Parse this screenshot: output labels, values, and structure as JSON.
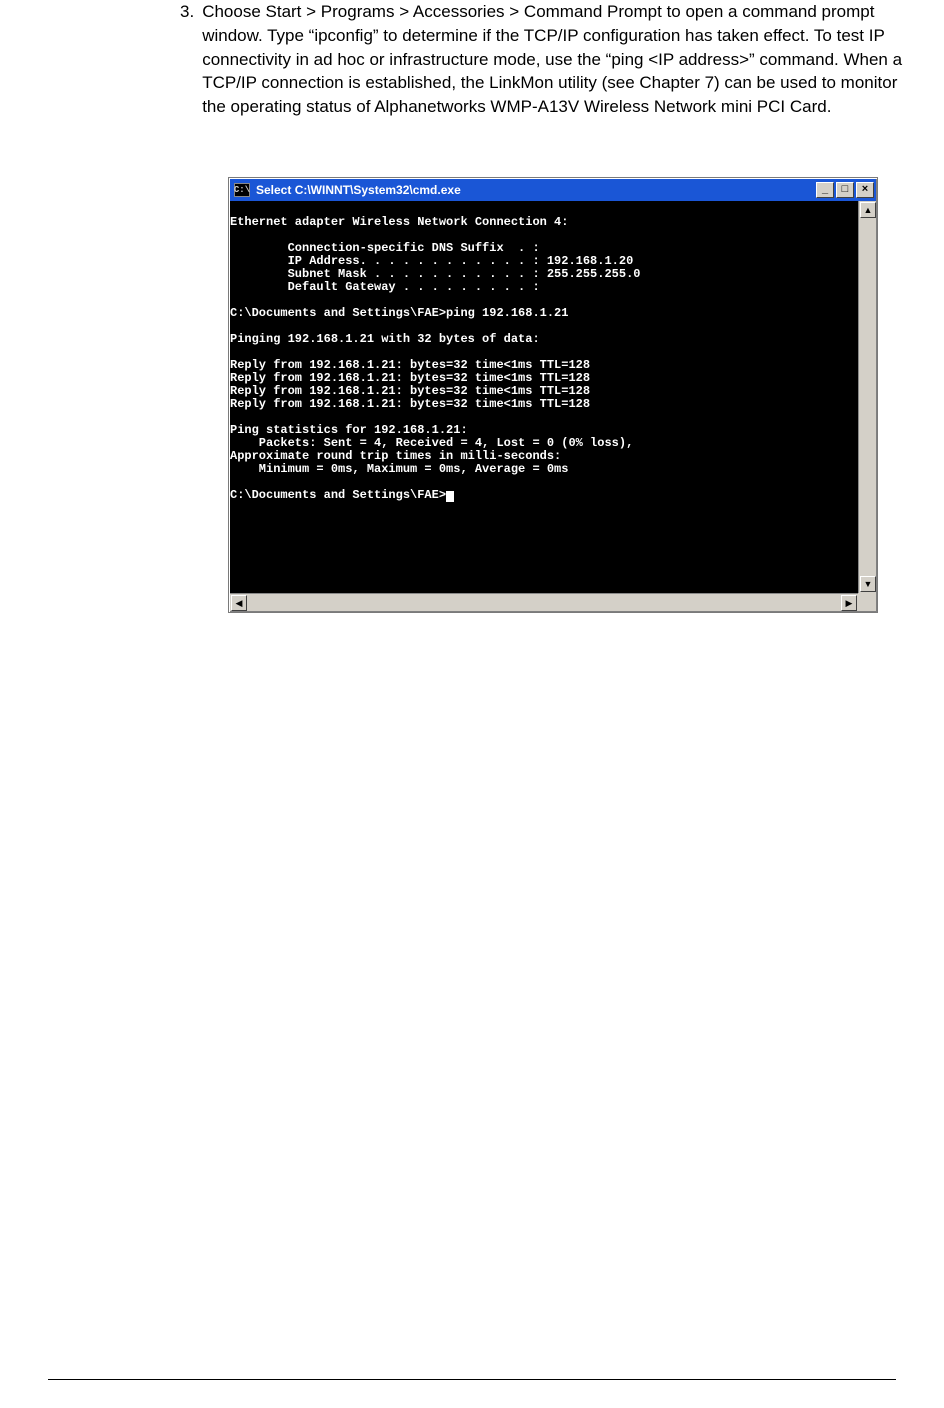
{
  "step_number": "3.",
  "step_text": "Choose Start > Programs > Accessories > Command Prompt to open a command prompt window. Type “ipconfig” to determine if the TCP/IP configuration has taken effect. To test IP connectivity in ad hoc or infrastructure mode, use the “ping <IP address>” command. When a TCP/IP connection is established, the LinkMon utility (see Chapter 7) can be used to monitor the operating status of Alphanetworks WMP-A13V Wireless Network mini PCI Card.",
  "window": {
    "icon_text": "C:\\",
    "title": "Select C:\\WINNT\\System32\\cmd.exe",
    "btn_min": "_",
    "btn_max": "□",
    "btn_close": "×",
    "scroll_up": "▲",
    "scroll_down": "▼",
    "scroll_left": "◀",
    "scroll_right": "▶"
  },
  "terminal_text": "\nEthernet adapter Wireless Network Connection 4:\n\n        Connection-specific DNS Suffix  . :\n        IP Address. . . . . . . . . . . . : 192.168.1.20\n        Subnet Mask . . . . . . . . . . . : 255.255.255.0\n        Default Gateway . . . . . . . . . :\n\nC:\\Documents and Settings\\FAE>ping 192.168.1.21\n\nPinging 192.168.1.21 with 32 bytes of data:\n\nReply from 192.168.1.21: bytes=32 time<1ms TTL=128\nReply from 192.168.1.21: bytes=32 time<1ms TTL=128\nReply from 192.168.1.21: bytes=32 time<1ms TTL=128\nReply from 192.168.1.21: bytes=32 time<1ms TTL=128\n\nPing statistics for 192.168.1.21:\n    Packets: Sent = 4, Received = 4, Lost = 0 (0% loss),\nApproximate round trip times in milli-seconds:\n    Minimum = 0ms, Maximum = 0ms, Average = 0ms\n\nC:\\Documents and Settings\\FAE>"
}
